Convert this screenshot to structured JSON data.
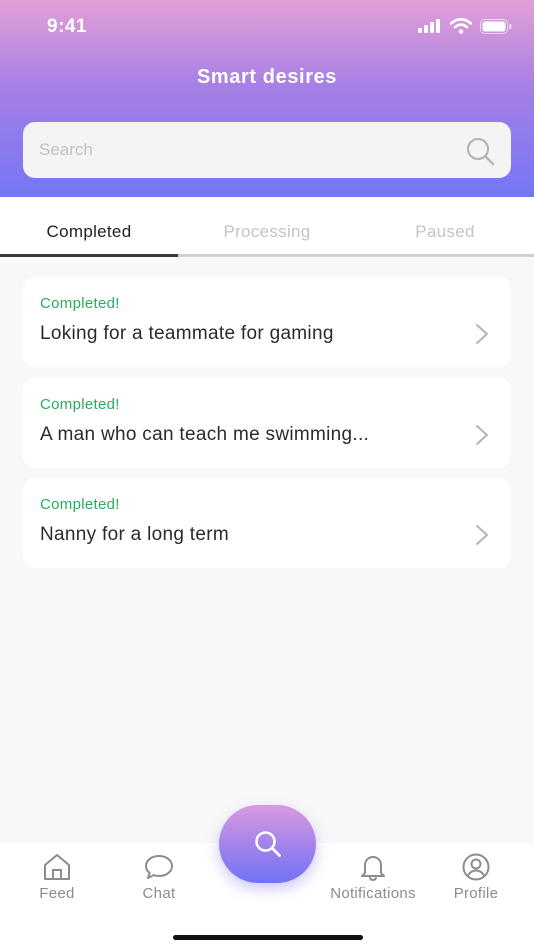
{
  "status_bar": {
    "time": "9:41"
  },
  "header": {
    "title": "Smart desires"
  },
  "search": {
    "placeholder": "Search"
  },
  "tabs": [
    {
      "label": "Completed",
      "active": true
    },
    {
      "label": "Processing",
      "active": false
    },
    {
      "label": "Paused",
      "active": false
    }
  ],
  "items": [
    {
      "status": "Completed!",
      "title": "Loking for a teammate for gaming"
    },
    {
      "status": "Completed!",
      "title": "A man who can teach me swimming..."
    },
    {
      "status": "Completed!",
      "title": "Nanny for a long term"
    }
  ],
  "bottom_nav": [
    {
      "label": "Feed",
      "icon": "home-icon"
    },
    {
      "label": "Chat",
      "icon": "chat-bubble-icon"
    },
    {
      "label": "Notifications",
      "icon": "bell-icon"
    },
    {
      "label": "Profile",
      "icon": "user-circle-icon"
    }
  ],
  "fab": {
    "icon": "search-icon"
  },
  "colors": {
    "accent_start": "#e39fd6",
    "accent_end": "#7476f5",
    "status_completed": "#27ae60",
    "tab_active": "#222222",
    "tab_inactive": "#c4c4c4"
  }
}
